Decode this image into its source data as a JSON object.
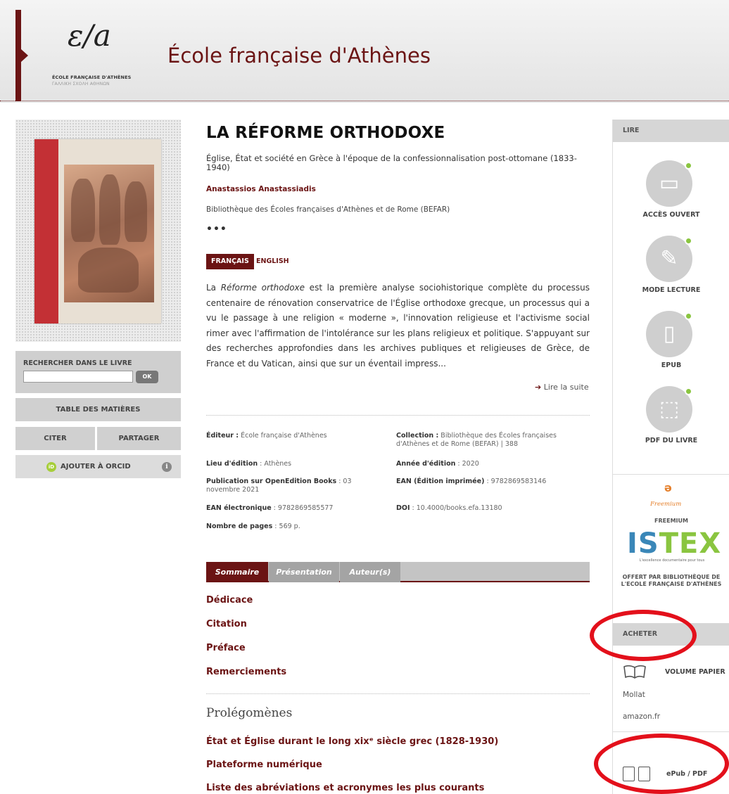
{
  "header": {
    "logo_mark": "ε∕a",
    "logo_line1": "ÉCOLE FRANÇAISE D'ATHÈNES",
    "logo_line2": "ΓΑΛΛΙΚΗ ΣΧΟΛΗ ΑΘΗΝΩΝ",
    "site_title": "École française d'Athènes"
  },
  "left": {
    "search_label": "RECHERCHER DANS LE LIVRE",
    "search_value": "",
    "search_button": "OK",
    "toc_button": "TABLE DES MATIÈRES",
    "cite_button": "CITER",
    "share_button": "PARTAGER",
    "orcid_button": "AJOUTER À ORCID",
    "orcid_icon": "iD",
    "info_icon": "i"
  },
  "book": {
    "title": "LA RÉFORME ORTHODOXE",
    "subtitle": "Église, État et société en Grèce à l'époque de la confessionnalisation post-ottomane (1833-1940)",
    "author": "Anastassios Anastassiadis",
    "series": "Bibliothèque des Écoles françaises d'Athènes et de Rome (BEFAR)",
    "more": "•••",
    "lang_fr": "FRANÇAIS",
    "lang_en": "ENGLISH",
    "abstract_em": "Réforme orthodoxe",
    "abstract_pre": "La ",
    "abstract_post": " est la première analyse sociohistorique complète du processus centenaire de rénovation conservatrice de l'Église orthodoxe grecque, un processus qui a vu le passage à une religion « moderne », l'innovation religieuse et l'activisme social rimer avec l'affirmation de l'intolérance sur les plans religieux et politique. S'appuyant sur des recherches approfondies dans les archives publiques et religieuses de Grèce, de France et du Vatican, ainsi que sur un éventail impress...",
    "read_more": "Lire la suite",
    "arrow": "➔"
  },
  "meta": {
    "editeur_k": "Éditeur :",
    "editeur_v": " École française d'Athènes",
    "collection_k": "Collection :",
    "collection_v": " Bibliothèque des Écoles françaises d'Athènes et de Rome (BEFAR) | 388",
    "lieu_k": "Lieu d'édition",
    "lieu_v": " : Athènes",
    "annee_k": "Année d'édition",
    "annee_v": " : 2020",
    "pub_k": "Publication sur OpenEdition Books",
    "pub_v": " : 03 novembre 2021",
    "ean_imp_k": "EAN (Édition imprimée)",
    "ean_imp_v": " : 9782869583146",
    "ean_el_k": "EAN électronique",
    "ean_el_v": " : 9782869585577",
    "doi_k": "DOI",
    "doi_v": " : 10.4000/books.efa.13180",
    "pages_k": "Nombre de pages",
    "pages_v": " : 569 p."
  },
  "tabs": [
    "Sommaire",
    "Présentation",
    "Auteur(s)"
  ],
  "toc": {
    "items": [
      "Dédicace",
      "Citation",
      "Préface",
      "Remerciements"
    ],
    "part": "Prolégomènes",
    "part_items": [
      "État et Église durant le long xixᵉ siècle grec (1828-1930)",
      "Plateforme numérique",
      "Liste des abréviations et acronymes les plus courants"
    ]
  },
  "sidebar": {
    "read_head": "LIRE",
    "read_items": [
      {
        "label": "ACCÈS OUVERT",
        "icon": "monitor-icon"
      },
      {
        "label": "MODE LECTURE",
        "icon": "lamp-icon"
      },
      {
        "label": "EPUB",
        "icon": "tablet-icon"
      },
      {
        "label": "PDF DU LIVRE",
        "icon": "pdf-icon"
      }
    ],
    "freemium_word": "Freemium",
    "freemium_label": "FREEMIUM",
    "istex_a": "IS",
    "istex_b": "TEX",
    "istex_tag": "L'excellence documentaire pour tous",
    "istex_offer": "OFFERT PAR BIBLIOTHÈQUE DE L'ECOLE FRANÇAISE D'ATHÈNES",
    "buy_head": "ACHETER",
    "paper_label": "VOLUME PAPIER",
    "vendors": [
      "Mollat",
      "amazon.fr"
    ],
    "epub_label": "ePub / PDF"
  },
  "colors": {
    "brand": "#6b1414",
    "annotation": "#e3101b",
    "available": "#8ac540"
  }
}
